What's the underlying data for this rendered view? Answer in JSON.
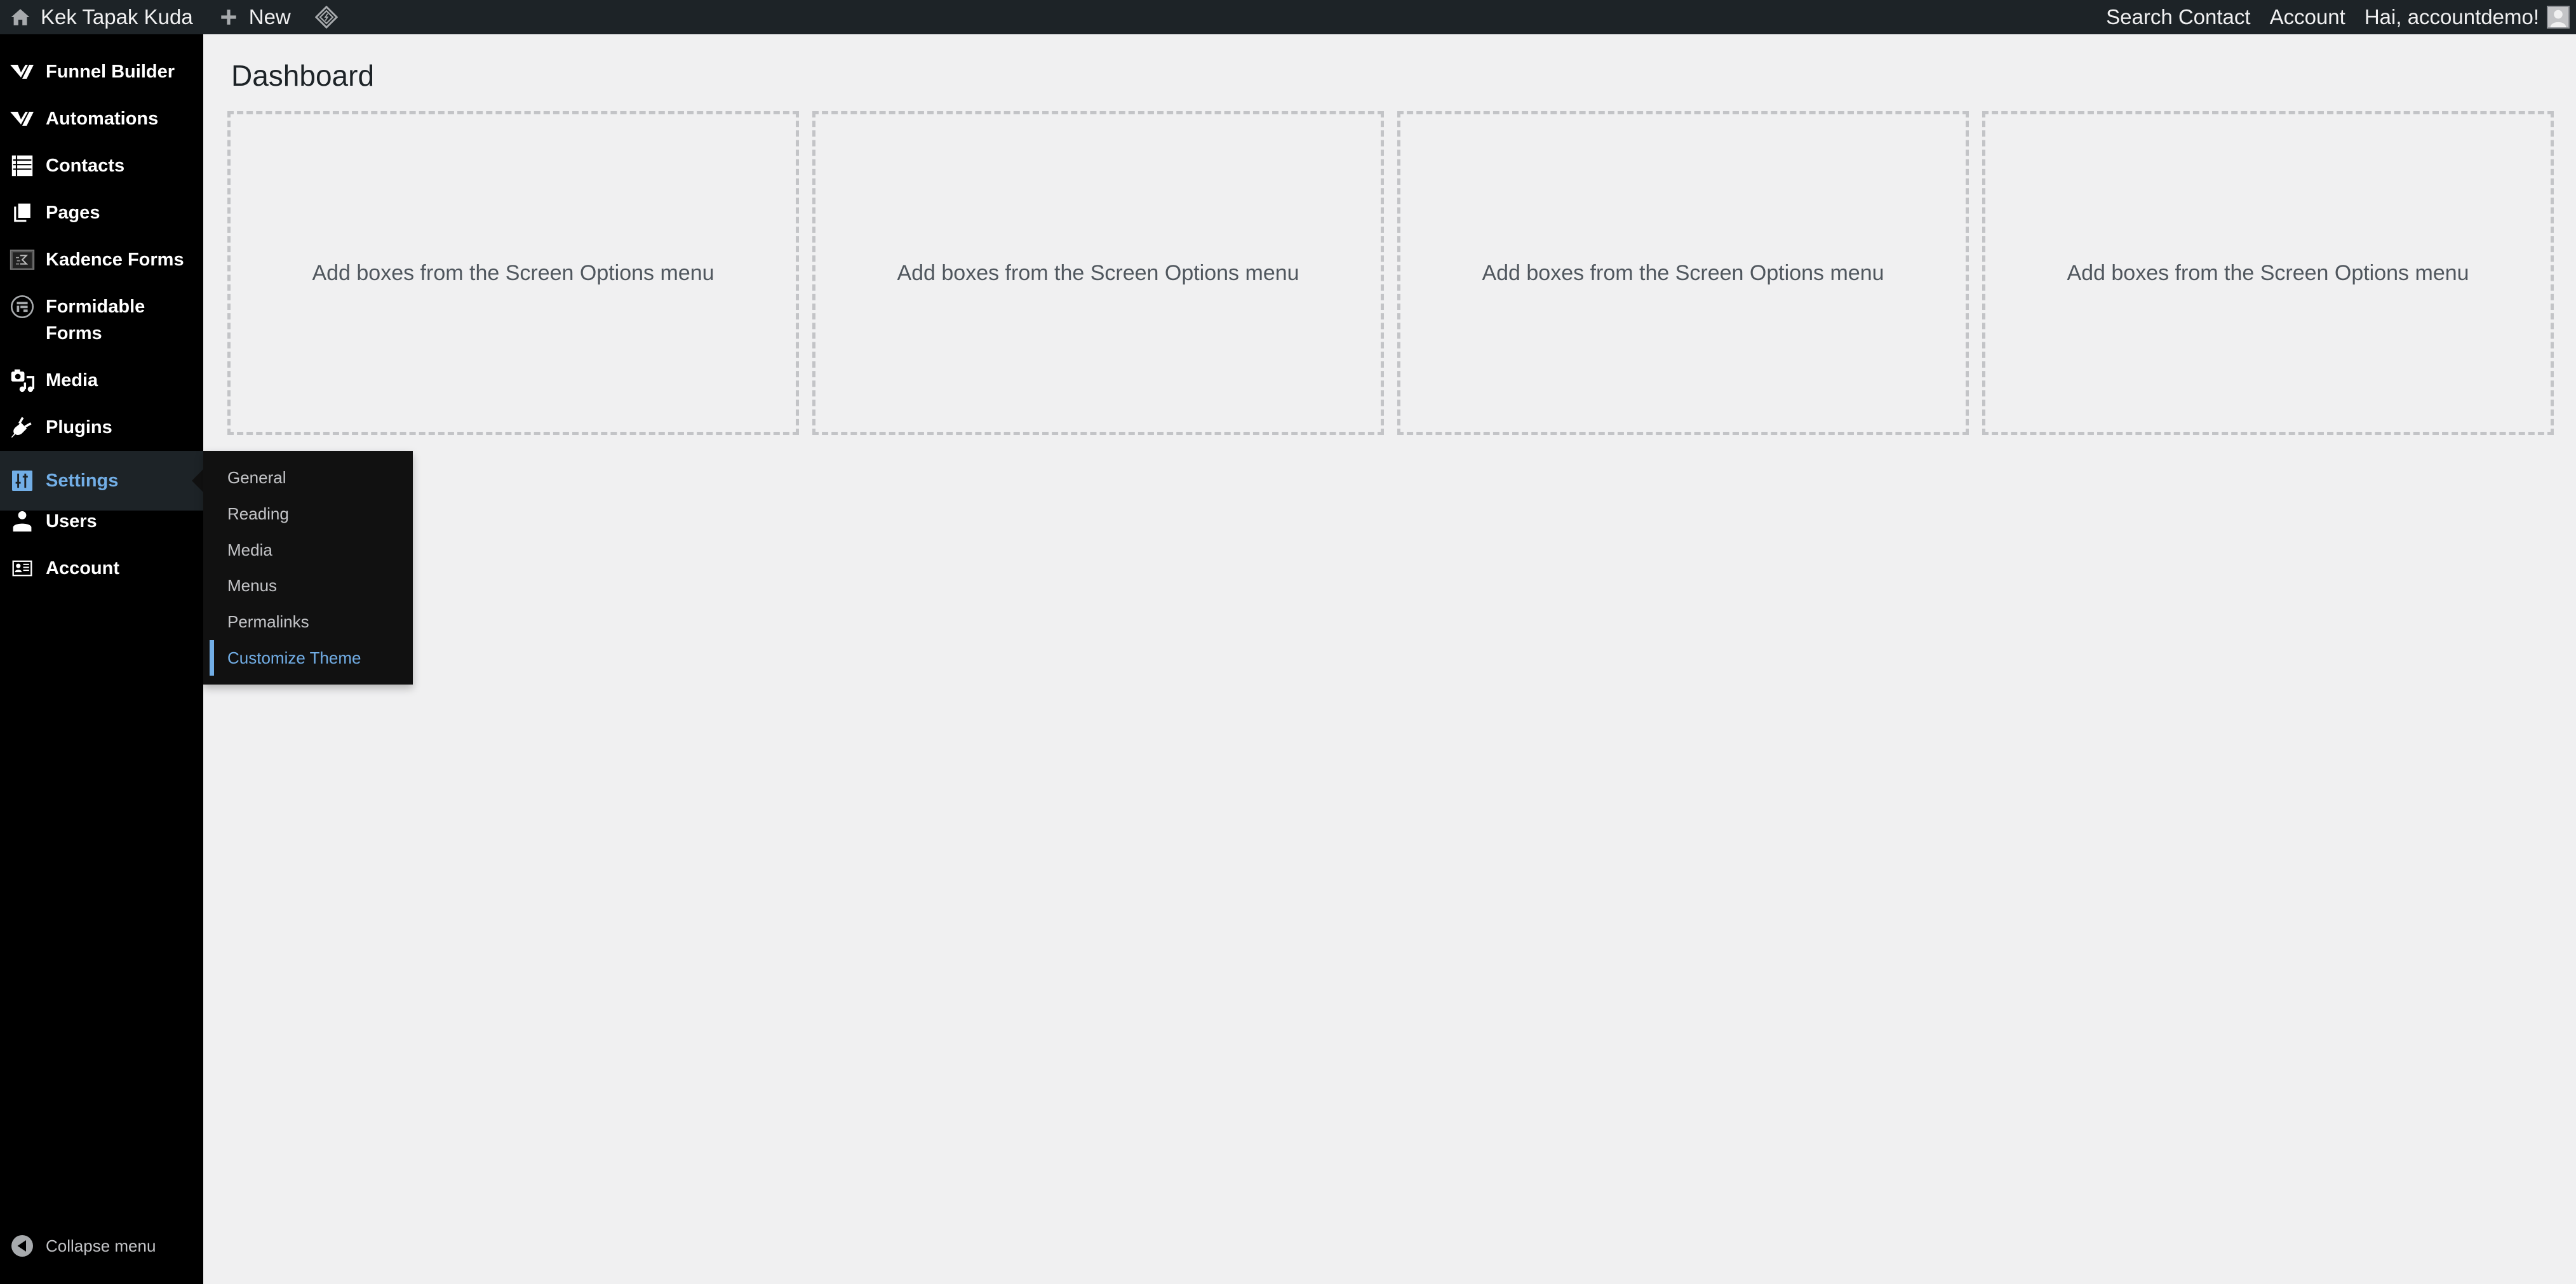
{
  "adminbar": {
    "site_name": "Kek Tapak Kuda",
    "new_label": "New",
    "plugin_icon": "diamond-plugin-icon",
    "search_contact": "Search Contact",
    "account": "Account",
    "greeting": "Hai, accountdemo!"
  },
  "sidebar": {
    "items": [
      {
        "label": "Funnel Builder",
        "icon": "funnelkit-icon"
      },
      {
        "label": "Automations",
        "icon": "funnelkit-icon"
      },
      {
        "label": "Contacts",
        "icon": "list-icon"
      },
      {
        "label": "Pages",
        "icon": "pages-icon"
      },
      {
        "label": "Kadence Forms",
        "icon": "kadence-icon"
      },
      {
        "label": "Formidable Forms",
        "icon": "formidable-icon"
      },
      {
        "label": "Media",
        "icon": "media-icon"
      },
      {
        "label": "Plugins",
        "icon": "plugins-icon"
      },
      {
        "label": "Settings",
        "icon": "settings-icon",
        "active": true
      },
      {
        "label": "Users",
        "icon": "users-icon"
      },
      {
        "label": "Account",
        "icon": "account-card-icon"
      }
    ],
    "collapse_label": "Collapse menu"
  },
  "settings_submenu": {
    "items": [
      {
        "label": "General"
      },
      {
        "label": "Reading"
      },
      {
        "label": "Media"
      },
      {
        "label": "Menus"
      },
      {
        "label": "Permalinks"
      },
      {
        "label": "Customize Theme",
        "current": true
      }
    ]
  },
  "main": {
    "title": "Dashboard",
    "boxes": [
      {
        "text": "Add boxes from the Screen Options menu"
      },
      {
        "text": "Add boxes from the Screen Options menu"
      },
      {
        "text": "Add boxes from the Screen Options menu"
      },
      {
        "text": "Add boxes from the Screen Options menu"
      }
    ]
  },
  "colors": {
    "adminbar_bg": "#1d2327",
    "sidebar_bg": "#000000",
    "accent": "#72aee6",
    "page_bg": "#f0f0f1"
  }
}
